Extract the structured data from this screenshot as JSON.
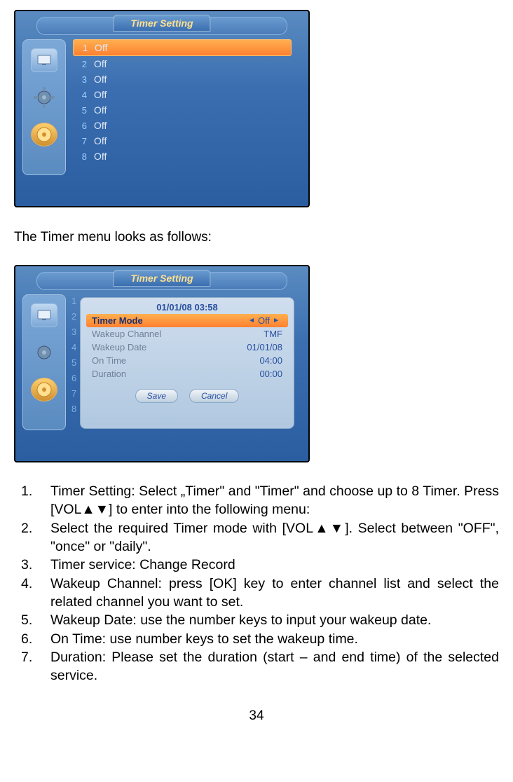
{
  "screenshot1": {
    "title": "Timer Setting",
    "timers": [
      {
        "num": "1",
        "status": "Off",
        "selected": true
      },
      {
        "num": "2",
        "status": "Off",
        "selected": false
      },
      {
        "num": "3",
        "status": "Off",
        "selected": false
      },
      {
        "num": "4",
        "status": "Off",
        "selected": false
      },
      {
        "num": "5",
        "status": "Off",
        "selected": false
      },
      {
        "num": "6",
        "status": "Off",
        "selected": false
      },
      {
        "num": "7",
        "status": "Off",
        "selected": false
      },
      {
        "num": "8",
        "status": "Off",
        "selected": false
      }
    ]
  },
  "introText": "The Timer menu looks as follows:",
  "screenshot2": {
    "title": "Timer Setting",
    "datetime": "01/01/08 03:58",
    "sideNums": [
      "1",
      "2",
      "3",
      "4",
      "5",
      "6",
      "7",
      "8"
    ],
    "rows": [
      {
        "label": "Timer Mode",
        "value": "Off",
        "selected": true,
        "arrows": true
      },
      {
        "label": "Wakeup Channel",
        "value": "TMF",
        "selected": false
      },
      {
        "label": "Wakeup Date",
        "value": "01/01/08",
        "selected": false
      },
      {
        "label": "On Time",
        "value": "04:00",
        "selected": false
      },
      {
        "label": "Duration",
        "value": "00:00",
        "selected": false
      }
    ],
    "buttons": {
      "save": "Save",
      "cancel": "Cancel"
    }
  },
  "instructions": [
    {
      "num": "1.",
      "text": "Timer Setting: Select „Timer\" and \"Timer\" and choose up to 8 Timer. Press [VOL▲▼] to enter into the following menu:"
    },
    {
      "num": "2.",
      "text": "Select the required Timer mode with [VOL▲▼]. Select between \"OFF\", \"once\" or \"daily\"."
    },
    {
      "num": "3.",
      "text": "Timer service: Change Record"
    },
    {
      "num": "4.",
      "text": "Wakeup Channel: press [OK] key to enter channel list and select the related channel you want to set."
    },
    {
      "num": "5.",
      "text": "Wakeup Date: use the number keys to input your wakeup date."
    },
    {
      "num": "6.",
      "text": "On Time: use number keys to set the wakeup time."
    },
    {
      "num": "7.",
      "text": "Duration: Please set the duration (start – and end time) of the selected service."
    }
  ],
  "pageNumber": "34"
}
